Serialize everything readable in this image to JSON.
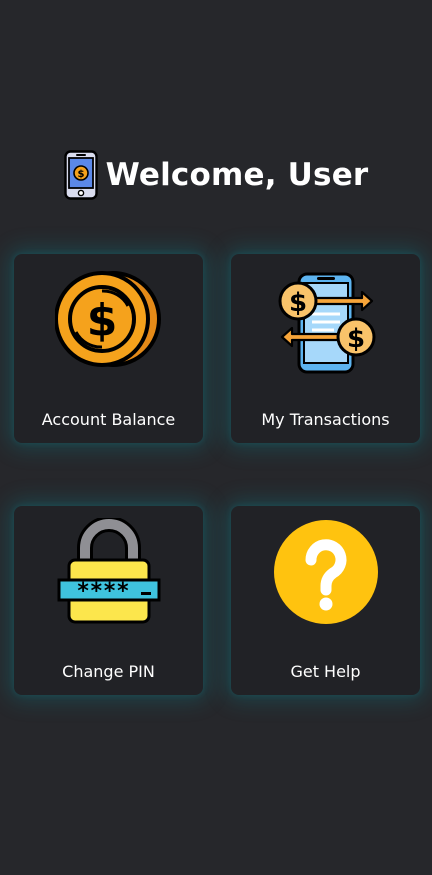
{
  "header": {
    "title": "Welcome, User",
    "logo_icon": "phone-dollar-icon"
  },
  "cards": [
    {
      "label": "Account Balance",
      "icon": "coin-dollar-icon"
    },
    {
      "label": "My Transactions",
      "icon": "transfer-phone-icon"
    },
    {
      "label": "Change PIN",
      "icon": "padlock-password-icon"
    },
    {
      "label": "Get Help",
      "icon": "question-mark-icon"
    }
  ],
  "colors": {
    "background": "#26272b",
    "card": "#212226",
    "glow": "#00aab4",
    "coin": "#f5a21c",
    "help": "#ffc30f",
    "lock_body": "#fce64c",
    "password_bar": "#3fc3de",
    "phone_screen": "#5db4f0"
  }
}
